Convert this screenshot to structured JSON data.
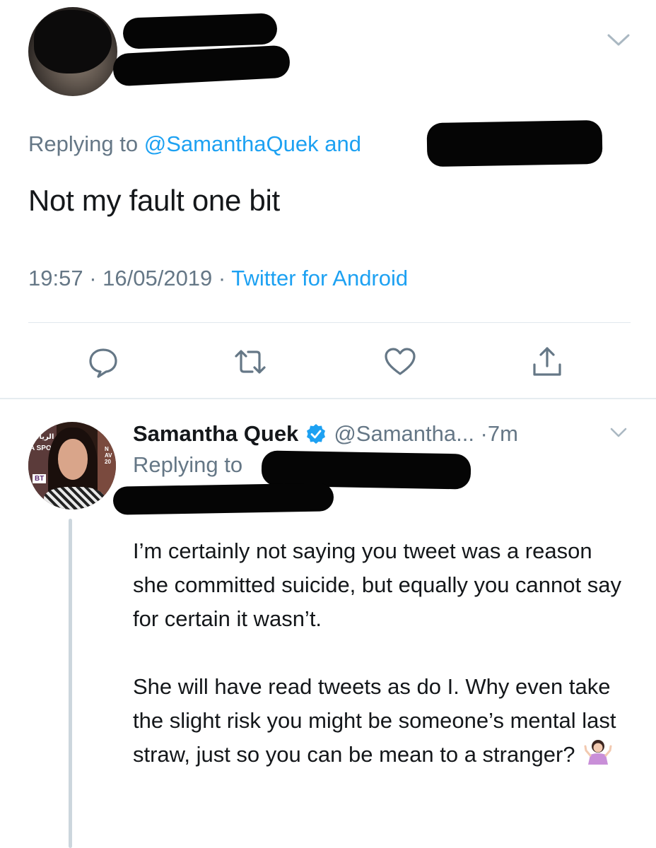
{
  "main_tweet": {
    "replying_prefix": "Replying to ",
    "replying_mention": "@SamanthaQuek and",
    "text": "Not my fault one bit",
    "time": "19:57",
    "separator": " · ",
    "date": "16/05/2019",
    "source": "Twitter for Android"
  },
  "actions": {
    "reply": "reply-icon",
    "retweet": "retweet-icon",
    "like": "heart-icon",
    "share": "share-icon"
  },
  "reply_tweet": {
    "name": "Samantha Quek",
    "handle_time": "@Samantha... ·7m",
    "replying_prefix": "Replying to",
    "paragraph_1": "I’m certainly not saying you tweet was a reason she committed suicide, but equally you cannot say for certain it wasn’t.",
    "paragraph_2": "She will have read tweets as do I. Why even take the slight risk you might be someone’s mental last straw,  just so you can be mean to a stranger?",
    "emoji": "person-shrugging-emoji",
    "avatar_text": {
      "arabic": "ة الرياض",
      "spo": "A SPO",
      "right": "N AV 20",
      "bt": "BT"
    }
  },
  "colors": {
    "text": "#14171a",
    "secondary": "#657786",
    "accent": "#1da1f2",
    "divider": "#e1e8ed",
    "thread_line": "#ccd6dd"
  }
}
